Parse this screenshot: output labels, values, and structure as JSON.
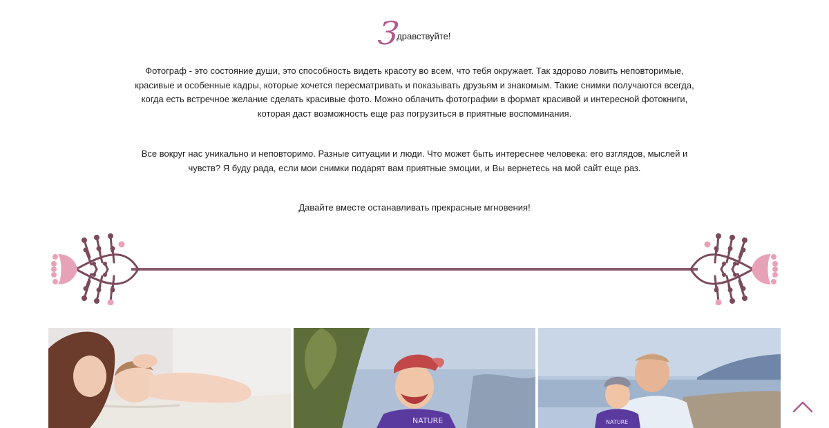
{
  "greeting": {
    "initial": "З",
    "rest": "дравствуйте!"
  },
  "paragraphs": {
    "p1": "Фотограф - это состояние души, это способность видеть красоту во всем, что тебя окружает. Так здорово ловить неповторимые, красивые и особенные кадры, которые хочется пересматривать и показывать друзьям и знакомым. Такие снимки получаются всегда, когда есть встречное желание сделать красивые фото. Можно облачить фотографии в формат красивой и интересной фотокниги, которая даст возможность еще раз погрузиться в приятные воспоминания.",
    "p2": "Все вокруг нас уникально и неповторимо. Разные ситуации и люди. Что может быть интереснее человека: его взглядов, мыслей и чувств? Я буду рада, если мои снимки подарят вам приятные эмоции, и Вы вернетесь на мой сайт еще раз.",
    "p3": "Давайте вместе останавливать прекрасные мгновения!"
  },
  "photos": {
    "photo2_shirt_text": "NATURE",
    "photo3_shirt_text": "NATURE"
  },
  "colors": {
    "accent": "#b05a8f",
    "divider_line": "#8a5a6e",
    "flower_pink": "#e8a2b8",
    "branch": "#7a4a5c"
  },
  "icons": {
    "scroll_top": "chevron-up-icon",
    "divider": "floral-divider-icon"
  }
}
